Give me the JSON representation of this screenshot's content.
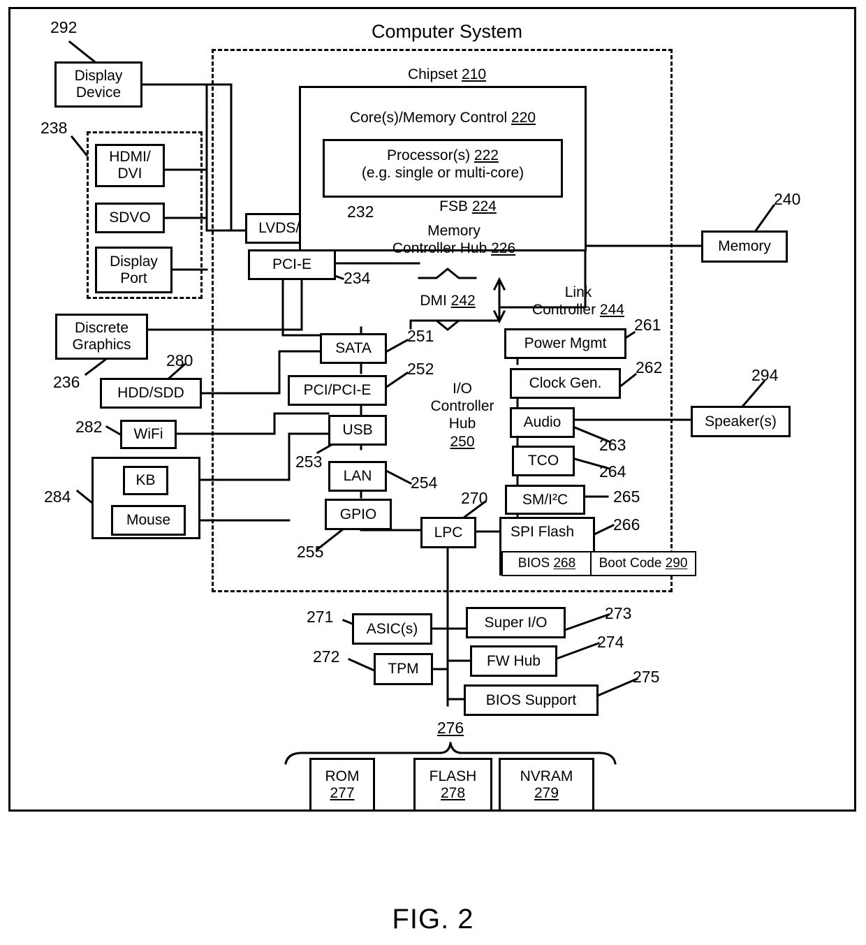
{
  "figure": {
    "caption": "FIG. 2",
    "title": "Computer System"
  },
  "groups": {
    "computer_system_boundary": "Computer System",
    "display_group_ref": "238",
    "input_group_ref": "284",
    "memory_group_ref": "276"
  },
  "chipset": {
    "label": "Chipset ",
    "ref": "210",
    "core_memory_control": {
      "label": "Core(s)/Memory Control ",
      "ref": "220"
    },
    "processors": {
      "line1": "Processor(s) ",
      "ref": "222",
      "line2": "(e.g. single or multi-core)"
    },
    "fsb": {
      "label": "FSB ",
      "ref": "224"
    },
    "memory_controller_hub": {
      "line1": "Memory",
      "line2": "Controller Hub ",
      "ref": "226"
    },
    "dmi": {
      "label": "DMI ",
      "ref": "242"
    },
    "link_controller": {
      "line1": "Link",
      "line2": "Controller ",
      "ref": "244"
    },
    "io_controller_hub": {
      "line1": "I/O",
      "line2": "Controller",
      "line3": "Hub",
      "ref": "250"
    }
  },
  "blocks": {
    "display_device": {
      "line1": "Display",
      "line2": "Device",
      "ref": "292"
    },
    "hdmi_dvi": {
      "line1": "HDMI/",
      "line2": "DVI"
    },
    "sdvo": {
      "label": "SDVO"
    },
    "display_port": {
      "line1": "Display",
      "line2": "Port"
    },
    "lvds_ldi": {
      "label": "LVDS/LDI",
      "ref": "232"
    },
    "pci_e_gfx": {
      "label": "PCI-E",
      "ref": "234"
    },
    "memory": {
      "label": "Memory",
      "ref": "240"
    },
    "discrete_graphics": {
      "line1": "Discrete",
      "line2": "Graphics",
      "ref": "236"
    },
    "hdd_sdd": {
      "label": "HDD/SDD",
      "ref": "280"
    },
    "wifi": {
      "label": "WiFi",
      "ref": "282"
    },
    "kb": {
      "label": "KB"
    },
    "mouse": {
      "label": "Mouse"
    },
    "sata": {
      "label": "SATA",
      "ref": "251"
    },
    "pci_pcie": {
      "label": "PCI/PCI-E",
      "ref": "252"
    },
    "usb": {
      "label": "USB",
      "ref": "253"
    },
    "lan": {
      "label": "LAN",
      "ref": "254"
    },
    "gpio": {
      "label": "GPIO",
      "ref": "255"
    },
    "power_mgmt": {
      "label": "Power Mgmt",
      "ref": "261"
    },
    "clock_gen": {
      "label": "Clock Gen.",
      "ref": "262"
    },
    "audio": {
      "label": "Audio",
      "ref": "263"
    },
    "tco": {
      "label": "TCO",
      "ref": "264"
    },
    "sm_i2c": {
      "label": "SM/I²C",
      "ref": "265"
    },
    "spi_flash": {
      "label": "SPI Flash",
      "ref": "266"
    },
    "bios": {
      "label": "BIOS ",
      "ref": "268"
    },
    "boot_code": {
      "label": "Boot Code ",
      "ref": "290"
    },
    "speakers": {
      "label": "Speaker(s)",
      "ref": "294"
    },
    "lpc": {
      "label": "LPC",
      "ref": "270"
    },
    "asics": {
      "label": "ASIC(s)",
      "ref": "271"
    },
    "tpm": {
      "label": "TPM",
      "ref": "272"
    },
    "super_io": {
      "label": "Super I/O",
      "ref": "273"
    },
    "fw_hub": {
      "label": "FW Hub",
      "ref": "274"
    },
    "bios_support": {
      "label": "BIOS Support",
      "ref": "275"
    },
    "rom": {
      "label": "ROM",
      "ref": "277"
    },
    "flash": {
      "label": "FLASH",
      "ref": "278"
    },
    "nvram": {
      "label": "NVRAM",
      "ref": "279"
    }
  },
  "colors": {
    "line": "#000000",
    "background": "#ffffff"
  }
}
